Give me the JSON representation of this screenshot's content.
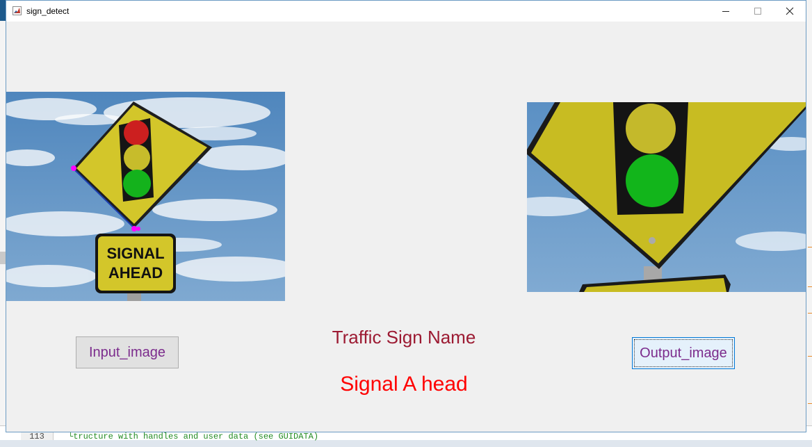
{
  "window": {
    "title": "sign_detect",
    "title_icon": "matlab-figure-icon",
    "controls": [
      "minimize-icon",
      "maximize-icon",
      "close-icon"
    ]
  },
  "input_image": {
    "sign_text_line1": "SIGNAL",
    "sign_text_line2": "AHEAD"
  },
  "buttons": {
    "input_label": "Input_image",
    "output_label": "Output_image"
  },
  "labels": {
    "traffic_sign_name": "Traffic Sign Name",
    "result": "Signal A head"
  },
  "background": {
    "line_number": "113",
    "code_comment": "└tructure with handles and user data (see GUIDATA)"
  },
  "colors": {
    "sky": "#5f93c4",
    "sign_yellow": "#d3c62a",
    "red_light": "#cc1f1f",
    "green_light": "#14b21c",
    "result_red": "#ff0000",
    "label_maroon": "#9c1a32",
    "button_text": "#7b2b8c"
  }
}
